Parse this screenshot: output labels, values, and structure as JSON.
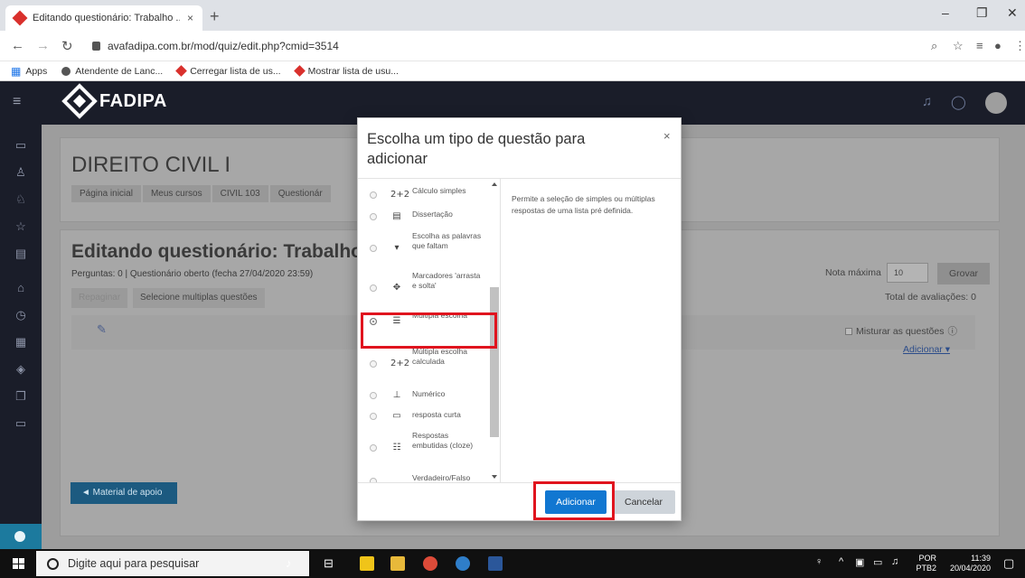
{
  "browser": {
    "tab_title": "Editando questionário: Trabalho ...",
    "tab_close": "×",
    "new_tab": "+",
    "url": "avafadipa.com.br/mod/quiz/edit.php?cmid=3514",
    "bookmarks": [
      {
        "label": "Apps"
      },
      {
        "label": "Atendente de Lanc..."
      },
      {
        "label": "Cerregar lista de us..."
      },
      {
        "label": "Mostrar lista de usu..."
      }
    ],
    "accent": "#1a73e8"
  },
  "app": {
    "brand": "FADIPA",
    "course_title": "DIREITO CIVIL I",
    "breadcrumb": [
      "Página inicial",
      "Meus cursos",
      "CIVIL 103",
      "Questionár"
    ],
    "edit_title": "Editando questionário: Trabalho",
    "quiz_meta": "Perguntas: 0 | Questionário oberto (fecha 27/04/2020 23:59)",
    "repaginate": "Repaginar",
    "select_multiple": "Selecione multiplas questões",
    "max_grade_label": "Nota máxima",
    "max_grade_value": "10",
    "save_label": "Grovar",
    "total_label": "Total de avaliações: 0",
    "shuffle_label": "Misturar as questões",
    "add_link": "Adicionar ▾",
    "material_label": "◄ Material de apoio",
    "nav_color": "#1a1d29"
  },
  "modal": {
    "title": "Escolha um tipo de questão para adicionar",
    "close": "×",
    "question_types": [
      {
        "label": "Cálculo simples",
        "icon": "2+2",
        "icon_name": "calculated-simple-icon",
        "selected": false
      },
      {
        "label": "Dissertação",
        "icon": "▤",
        "icon_name": "essay-icon",
        "selected": false
      },
      {
        "label": "Escolha as palavras que faltam",
        "icon": "▾",
        "icon_name": "dropdown-icon",
        "selected": false
      },
      {
        "label": "Marcadores 'arrasta e solta'",
        "icon": "✥",
        "icon_name": "drag-drop-icon",
        "selected": false
      },
      {
        "label": "Múltipla escolha",
        "icon": "☰",
        "icon_name": "list-icon",
        "selected": true
      },
      {
        "label": "Múltipla escolha calculada",
        "icon": "2+2",
        "icon_name": "calculated-multi-icon",
        "selected": false
      },
      {
        "label": "Numérico",
        "icon": "⊥",
        "icon_name": "numeric-icon",
        "selected": false
      },
      {
        "label": "resposta curta",
        "icon": "▭",
        "icon_name": "short-answer-icon",
        "selected": false
      },
      {
        "label": "Respostas embutidas (cloze)",
        "icon": "☷",
        "icon_name": "cloze-icon",
        "selected": false
      },
      {
        "label": "Verdadeiro/Falso",
        "icon": "",
        "icon_name": "truefalse-icon",
        "selected": false
      }
    ],
    "description": "Permite a seleção de simples ou múltiplas respostas de uma lista pré definida.",
    "add_button": "Adicionar",
    "cancel_button": "Cancelar",
    "primary_color": "#1177d1",
    "highlight_color": "#e0141e"
  },
  "taskbar": {
    "search_placeholder": "Digite aqui para pesquisar",
    "lang": "POR",
    "layout": "PTB2",
    "time": "11:39",
    "date": "20/04/2020"
  }
}
